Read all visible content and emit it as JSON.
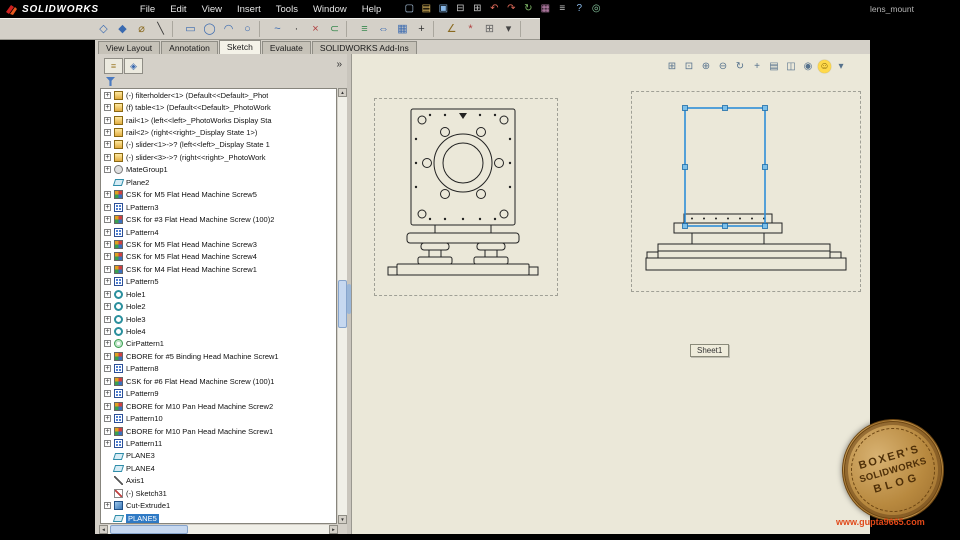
{
  "window": {
    "document_name": "lens_mount"
  },
  "menubar": {
    "brand": "SOLIDWORKS",
    "menus": [
      "File",
      "Edit",
      "View",
      "Insert",
      "Tools",
      "Window",
      "Help"
    ],
    "icons": [
      {
        "name": "new-document-icon",
        "glyph": "▢",
        "color": "#b8d4f0"
      },
      {
        "name": "open-icon",
        "glyph": "▤",
        "color": "#e8c060"
      },
      {
        "name": "save-icon",
        "glyph": "▣",
        "color": "#88b8e8"
      },
      {
        "name": "print-icon",
        "glyph": "⊟",
        "color": "#c8c8c8"
      },
      {
        "name": "print-preview-icon",
        "glyph": "⊞",
        "color": "#c8c8c8"
      },
      {
        "name": "undo-icon",
        "glyph": "↶",
        "color": "#e06a5a"
      },
      {
        "name": "redo-icon",
        "glyph": "↷",
        "color": "#e06a5a"
      },
      {
        "name": "rebuild-icon",
        "glyph": "↻",
        "color": "#7fb868"
      },
      {
        "name": "edit-color-icon",
        "glyph": "▦",
        "color": "#c88ab8"
      },
      {
        "name": "options-icon",
        "glyph": "≡",
        "color": "#c8c8c8"
      },
      {
        "name": "help-icon",
        "glyph": "?",
        "color": "#88b8e8"
      },
      {
        "name": "web-icon",
        "glyph": "◎",
        "color": "#88c8a0"
      }
    ]
  },
  "toolbar": {
    "icons": [
      {
        "name": "select-icon",
        "glyph": "◇",
        "color": "#3a6ab0"
      },
      {
        "name": "sketch-icon",
        "glyph": "◆",
        "color": "#3a6ab0"
      },
      {
        "name": "smart-dimension-icon",
        "glyph": "⌀",
        "color": "#8a6a20"
      },
      {
        "name": "line-icon",
        "glyph": "╲",
        "color": "#333333"
      },
      {
        "name": "rectangle-icon",
        "glyph": "▭",
        "color": "#3a6ab0"
      },
      {
        "name": "circle-icon",
        "glyph": "◯",
        "color": "#3a6ab0"
      },
      {
        "name": "arc-icon",
        "glyph": "◠",
        "color": "#3a6ab0"
      },
      {
        "name": "ellipse-icon",
        "glyph": "○",
        "color": "#3a6ab0"
      },
      {
        "name": "spline-icon",
        "glyph": "~",
        "color": "#3a6ab0"
      },
      {
        "name": "point-icon",
        "glyph": "·",
        "color": "#333333"
      },
      {
        "name": "trim-icon",
        "glyph": "×",
        "color": "#b04040"
      },
      {
        "name": "convert-entities-icon",
        "glyph": "⊂",
        "color": "#3a8a50"
      },
      {
        "name": "offset-entities-icon",
        "glyph": "≡",
        "color": "#3a8a50"
      },
      {
        "name": "mirror-icon",
        "glyph": "⇔",
        "color": "#3a6ab0"
      },
      {
        "name": "linear-pattern-icon",
        "glyph": "▦",
        "color": "#3a6ab0"
      },
      {
        "name": "move-entities-icon",
        "glyph": "+",
        "color": "#333333"
      },
      {
        "name": "display-relations-icon",
        "glyph": "∠",
        "color": "#8a6a20"
      },
      {
        "name": "repair-sketch-icon",
        "glyph": "*",
        "color": "#b04040"
      },
      {
        "name": "grid-icon",
        "glyph": "⊞",
        "color": "#666666"
      },
      {
        "name": "dropdown-icon",
        "glyph": "▾",
        "color": "#444444"
      }
    ]
  },
  "command_tabs": [
    {
      "label": "View Layout",
      "active": false
    },
    {
      "label": "Annotation",
      "active": false
    },
    {
      "label": "Sketch",
      "active": true
    },
    {
      "label": "Evaluate",
      "active": false
    },
    {
      "label": "SOLIDWORKS Add-Ins",
      "active": false
    }
  ],
  "feature_tree": {
    "panel_tabs": [
      {
        "name": "featuremanager-tree-tab",
        "glyph": "≡",
        "color": "#a08030"
      },
      {
        "name": "configuration-manager-tab",
        "glyph": "◈",
        "color": "#3a6ab0"
      }
    ],
    "overflow_chevron": "»",
    "items": [
      {
        "label": "(-) filterholder<1> (Default<<Default>_Phot",
        "icon": "component",
        "expandable": true
      },
      {
        "label": "(f) table<1> (Default<<Default>_PhotoWork",
        "icon": "component",
        "expandable": true
      },
      {
        "label": "rail<1> (left<<left>_PhotoWorks Display Sta",
        "icon": "component",
        "expandable": true
      },
      {
        "label": "rail<2> (right<<right>_Display State 1>)",
        "icon": "component",
        "expandable": true
      },
      {
        "label": "(-) slider<1>->? (left<<left>_Display State 1",
        "icon": "component",
        "expandable": true
      },
      {
        "label": "(-) slider<3>->? (right<<right>_PhotoWork",
        "icon": "component",
        "expandable": true
      },
      {
        "label": "MateGroup1",
        "icon": "mategroup",
        "expandable": true
      },
      {
        "label": "Plane2",
        "icon": "plane",
        "expandable": false
      },
      {
        "label": "CSK for M5 Flat Head Machine Screw5",
        "icon": "holewizard",
        "expandable": true
      },
      {
        "label": "LPattern3",
        "icon": "lpattern",
        "expandable": true
      },
      {
        "label": "CSK for #3 Flat Head Machine Screw (100)2",
        "icon": "holewizard",
        "expandable": true
      },
      {
        "label": "LPattern4",
        "icon": "lpattern",
        "expandable": true
      },
      {
        "label": "CSK for M5 Flat Head Machine Screw3",
        "icon": "holewizard",
        "expandable": true
      },
      {
        "label": "CSK for M5 Flat Head Machine Screw4",
        "icon": "holewizard",
        "expandable": true
      },
      {
        "label": "CSK for M4 Flat Head Machine Screw1",
        "icon": "holewizard",
        "expandable": true
      },
      {
        "label": "LPattern5",
        "icon": "lpattern",
        "expandable": true
      },
      {
        "label": "Hole1",
        "icon": "hole",
        "expandable": true
      },
      {
        "label": "Hole2",
        "icon": "hole",
        "expandable": true
      },
      {
        "label": "Hole3",
        "icon": "hole",
        "expandable": true
      },
      {
        "label": "Hole4",
        "icon": "hole",
        "expandable": true
      },
      {
        "label": "CirPattern1",
        "icon": "cirpattern",
        "expandable": true
      },
      {
        "label": "CBORE for #5 Binding Head Machine Screw1",
        "icon": "holewizard",
        "expandable": true
      },
      {
        "label": "LPattern8",
        "icon": "lpattern",
        "expandable": true
      },
      {
        "label": "CSK for #6 Flat Head Machine Screw (100)1",
        "icon": "holewizard",
        "expandable": true
      },
      {
        "label": "LPattern9",
        "icon": "lpattern",
        "expandable": true
      },
      {
        "label": "CBORE for M10 Pan Head Machine Screw2",
        "icon": "holewizard",
        "expandable": true
      },
      {
        "label": "LPattern10",
        "icon": "lpattern",
        "expandable": true
      },
      {
        "label": "CBORE for M10 Pan Head Machine Screw1",
        "icon": "holewizard",
        "expandable": true
      },
      {
        "label": "LPattern11",
        "icon": "lpattern",
        "expandable": true
      },
      {
        "label": "PLANE3",
        "icon": "plane",
        "expandable": false
      },
      {
        "label": "PLANE4",
        "icon": "plane",
        "expandable": false
      },
      {
        "label": "Axis1",
        "icon": "axis",
        "expandable": false
      },
      {
        "label": "(-) Sketch31",
        "icon": "sketch",
        "expandable": false
      },
      {
        "label": "Cut-Extrude1",
        "icon": "cutextrude",
        "expandable": true
      },
      {
        "label": "PLANE5",
        "icon": "plane",
        "expandable": false,
        "selected": true
      }
    ]
  },
  "canvas": {
    "sheet_label": "Sheet1",
    "view_toolbar": [
      {
        "name": "zoom-to-fit-icon",
        "glyph": "⊞"
      },
      {
        "name": "zoom-to-area-icon",
        "glyph": "⊡"
      },
      {
        "name": "zoom-in-icon",
        "glyph": "⊕"
      },
      {
        "name": "zoom-out-icon",
        "glyph": "⊖"
      },
      {
        "name": "rotate-view-icon",
        "glyph": "↻"
      },
      {
        "name": "pan-icon",
        "glyph": "+"
      },
      {
        "name": "standard-views-icon",
        "glyph": "▤"
      },
      {
        "name": "display-style-icon",
        "glyph": "◫"
      },
      {
        "name": "hide-show-icon",
        "glyph": "◉"
      },
      {
        "name": "quick-tips-icon",
        "glyph": "☺",
        "yellow": true
      },
      {
        "name": "collapse-icon",
        "glyph": "▾"
      }
    ]
  },
  "watermark": {
    "arc_top": "BOXER'S",
    "middle": "SOLIDWORKS",
    "arc_bottom": "BLOG",
    "url": "www.gupta9665.com"
  },
  "colors": {
    "chrome_bg": "#d4d0c8",
    "canvas_bg": "#ebe8d9",
    "selection_blue": "#2f7ac5",
    "sketch_blue": "#2e8ed8",
    "watermark_brown": "#96682a",
    "url_red": "#e04818"
  }
}
